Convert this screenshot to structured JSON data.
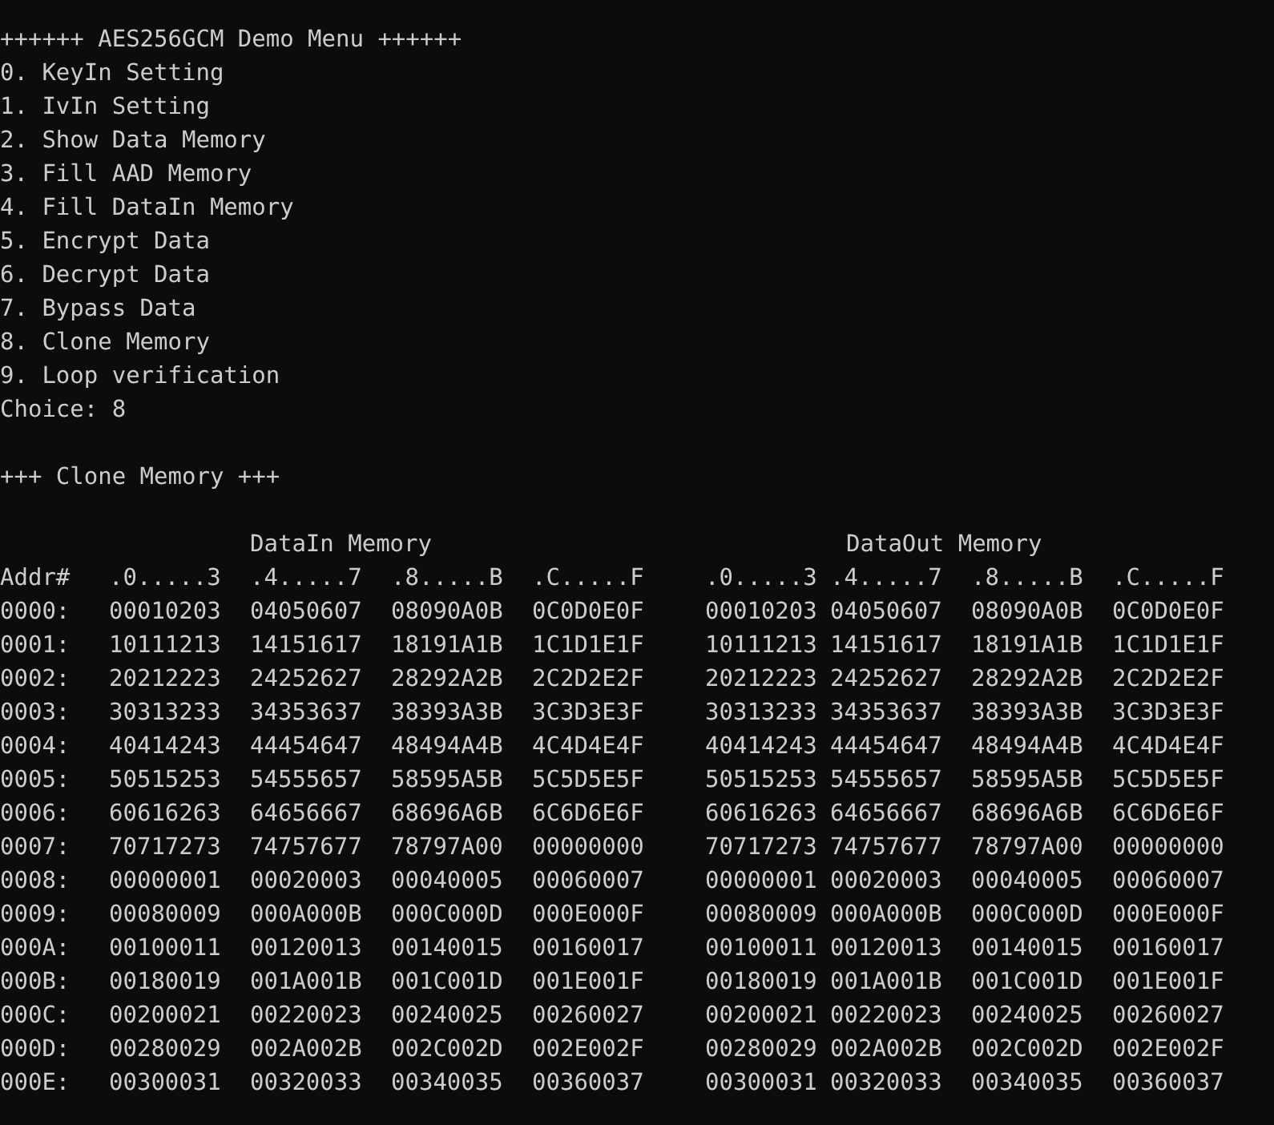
{
  "menu": {
    "title": "++++++ AES256GCM Demo Menu ++++++",
    "items": [
      "0. KeyIn Setting",
      "1. IvIn Setting",
      "2. Show Data Memory",
      "3. Fill AAD Memory",
      "4. Fill DataIn Memory",
      "5. Encrypt Data",
      "6. Decrypt Data",
      "7. Bypass Data",
      "8. Clone Memory",
      "9. Loop verification"
    ],
    "prompt": "Choice: 8"
  },
  "section_title": "+++ Clone Memory +++",
  "table": {
    "address_header": "Addr#",
    "groups": [
      {
        "title": "DataIn Memory",
        "columns": [
          ".0.....3",
          ".4.....7",
          ".8.....B",
          ".C.....F"
        ]
      },
      {
        "title": "DataOut Memory",
        "columns": [
          ".0.....3",
          ".4.....7",
          ".8.....B",
          ".C.....F"
        ]
      }
    ],
    "rows": [
      {
        "address": "0000:",
        "data_in": [
          "00010203",
          "04050607",
          "08090A0B",
          "0C0D0E0F"
        ],
        "data_out": [
          "00010203",
          "04050607",
          "08090A0B",
          "0C0D0E0F"
        ]
      },
      {
        "address": "0001:",
        "data_in": [
          "10111213",
          "14151617",
          "18191A1B",
          "1C1D1E1F"
        ],
        "data_out": [
          "10111213",
          "14151617",
          "18191A1B",
          "1C1D1E1F"
        ]
      },
      {
        "address": "0002:",
        "data_in": [
          "20212223",
          "24252627",
          "28292A2B",
          "2C2D2E2F"
        ],
        "data_out": [
          "20212223",
          "24252627",
          "28292A2B",
          "2C2D2E2F"
        ]
      },
      {
        "address": "0003:",
        "data_in": [
          "30313233",
          "34353637",
          "38393A3B",
          "3C3D3E3F"
        ],
        "data_out": [
          "30313233",
          "34353637",
          "38393A3B",
          "3C3D3E3F"
        ]
      },
      {
        "address": "0004:",
        "data_in": [
          "40414243",
          "44454647",
          "48494A4B",
          "4C4D4E4F"
        ],
        "data_out": [
          "40414243",
          "44454647",
          "48494A4B",
          "4C4D4E4F"
        ]
      },
      {
        "address": "0005:",
        "data_in": [
          "50515253",
          "54555657",
          "58595A5B",
          "5C5D5E5F"
        ],
        "data_out": [
          "50515253",
          "54555657",
          "58595A5B",
          "5C5D5E5F"
        ]
      },
      {
        "address": "0006:",
        "data_in": [
          "60616263",
          "64656667",
          "68696A6B",
          "6C6D6E6F"
        ],
        "data_out": [
          "60616263",
          "64656667",
          "68696A6B",
          "6C6D6E6F"
        ]
      },
      {
        "address": "0007:",
        "data_in": [
          "70717273",
          "74757677",
          "78797A00",
          "00000000"
        ],
        "data_out": [
          "70717273",
          "74757677",
          "78797A00",
          "00000000"
        ]
      },
      {
        "address": "0008:",
        "data_in": [
          "00000001",
          "00020003",
          "00040005",
          "00060007"
        ],
        "data_out": [
          "00000001",
          "00020003",
          "00040005",
          "00060007"
        ]
      },
      {
        "address": "0009:",
        "data_in": [
          "00080009",
          "000A000B",
          "000C000D",
          "000E000F"
        ],
        "data_out": [
          "00080009",
          "000A000B",
          "000C000D",
          "000E000F"
        ]
      },
      {
        "address": "000A:",
        "data_in": [
          "00100011",
          "00120013",
          "00140015",
          "00160017"
        ],
        "data_out": [
          "00100011",
          "00120013",
          "00140015",
          "00160017"
        ]
      },
      {
        "address": "000B:",
        "data_in": [
          "00180019",
          "001A001B",
          "001C001D",
          "001E001F"
        ],
        "data_out": [
          "00180019",
          "001A001B",
          "001C001D",
          "001E001F"
        ]
      },
      {
        "address": "000C:",
        "data_in": [
          "00200021",
          "00220023",
          "00240025",
          "00260027"
        ],
        "data_out": [
          "00200021",
          "00220023",
          "00240025",
          "00260027"
        ]
      },
      {
        "address": "000D:",
        "data_in": [
          "00280029",
          "002A002B",
          "002C002D",
          "002E002F"
        ],
        "data_out": [
          "00280029",
          "002A002B",
          "002C002D",
          "002E002F"
        ]
      },
      {
        "address": "000E:",
        "data_in": [
          "00300031",
          "00320033",
          "00340035",
          "00360037"
        ],
        "data_out": [
          "00300031",
          "00320033",
          "00340035",
          "00360037"
        ]
      }
    ]
  }
}
